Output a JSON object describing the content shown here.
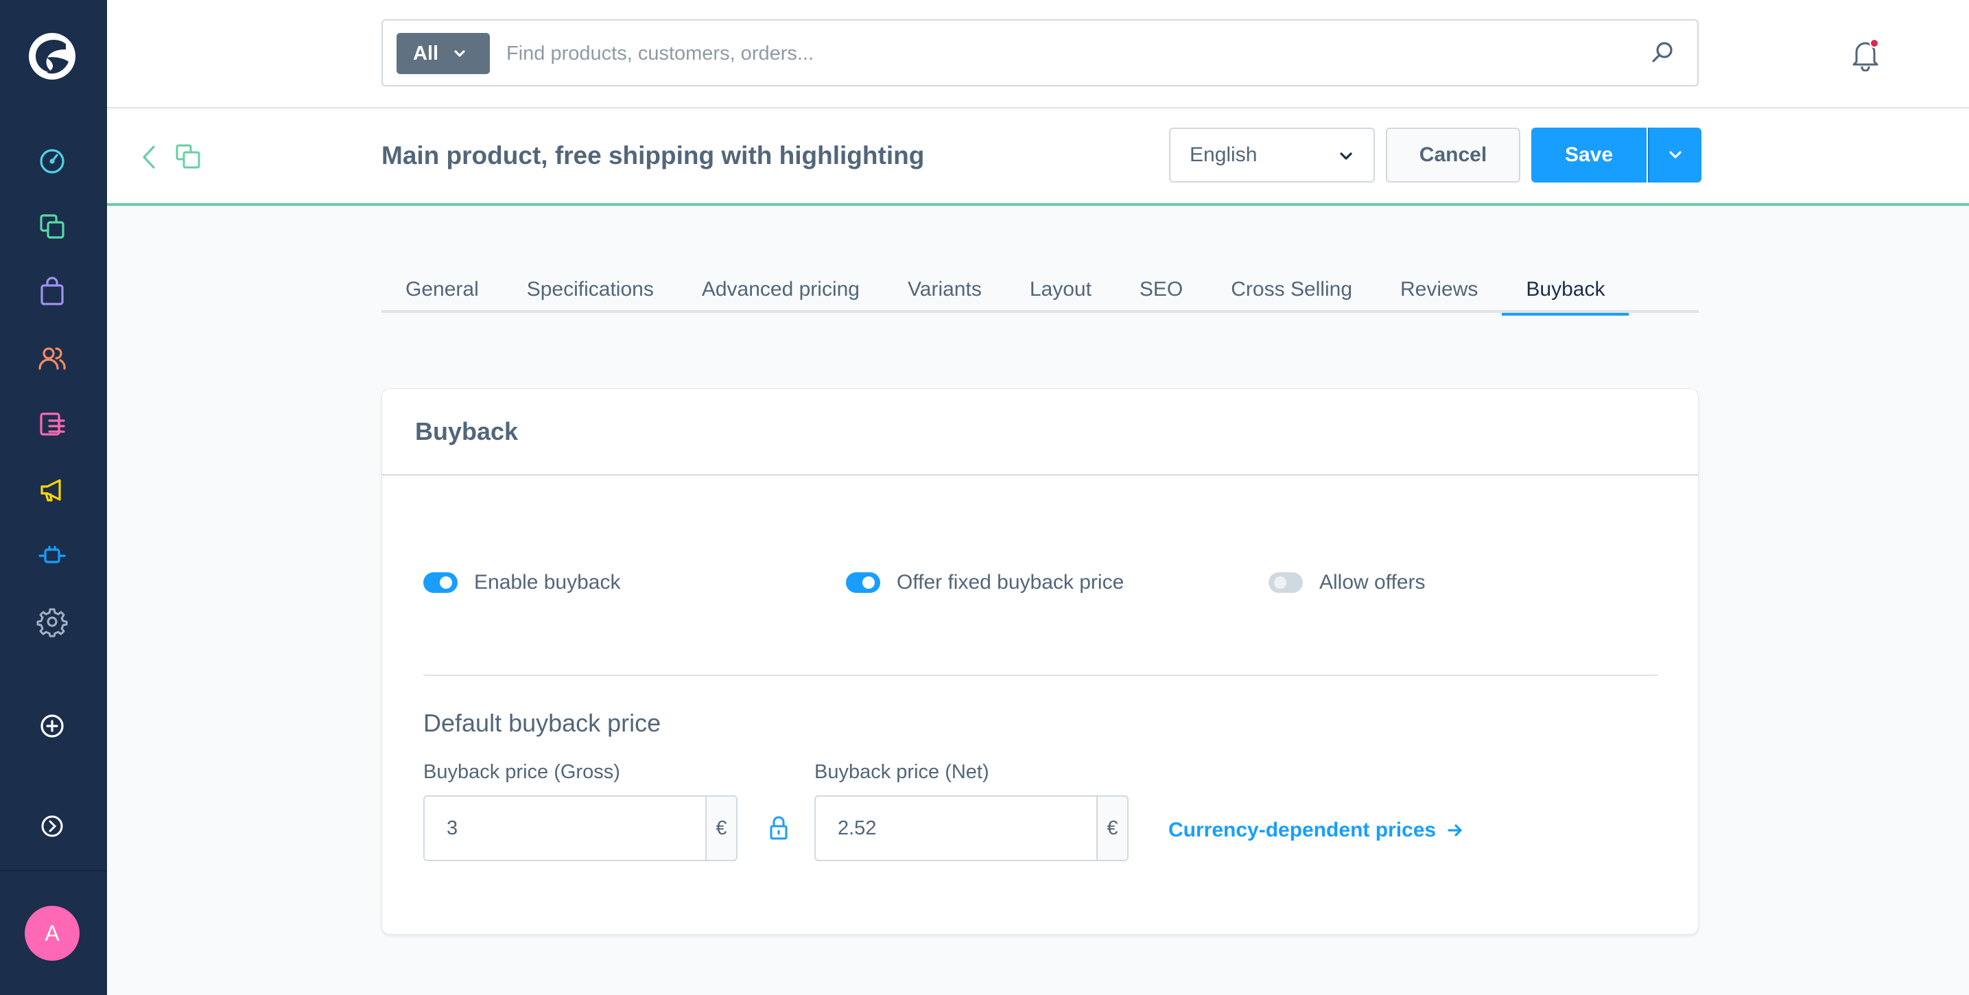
{
  "sidebar": {
    "avatar_initial": "A",
    "items": [
      "dashboard-icon",
      "catalogues-icon",
      "orders-icon",
      "customers-icon",
      "content-icon",
      "marketing-icon",
      "extensions-icon",
      "settings-icon",
      "add-icon",
      "collapse-icon"
    ]
  },
  "search": {
    "type_label": "All",
    "placeholder": "Find products, customers, orders..."
  },
  "header": {
    "title": "Main product, free shipping with highlighting",
    "language": "English",
    "cancel_label": "Cancel",
    "save_label": "Save"
  },
  "tabs": [
    {
      "label": "General"
    },
    {
      "label": "Specifications"
    },
    {
      "label": "Advanced pricing"
    },
    {
      "label": "Variants"
    },
    {
      "label": "Layout"
    },
    {
      "label": "SEO"
    },
    {
      "label": "Cross Selling"
    },
    {
      "label": "Reviews"
    },
    {
      "label": "Buyback",
      "active": true
    }
  ],
  "card": {
    "title": "Buyback",
    "switches": [
      {
        "label": "Enable buyback",
        "on": true
      },
      {
        "label": "Offer fixed buyback price",
        "on": true
      },
      {
        "label": "Allow offers",
        "on": false
      }
    ],
    "section_title": "Default buyback price",
    "gross_label": "Buyback price (Gross)",
    "gross_value": "3",
    "net_label": "Buyback price (Net)",
    "net_value": "2.52",
    "currency_symbol": "€",
    "currency_link": "Currency-dependent prices"
  },
  "colors": {
    "sidebar_bg": "#1b2e4b",
    "primary": "#189eff",
    "success_border": "#66d0a3",
    "avatar": "#ff68b4"
  }
}
